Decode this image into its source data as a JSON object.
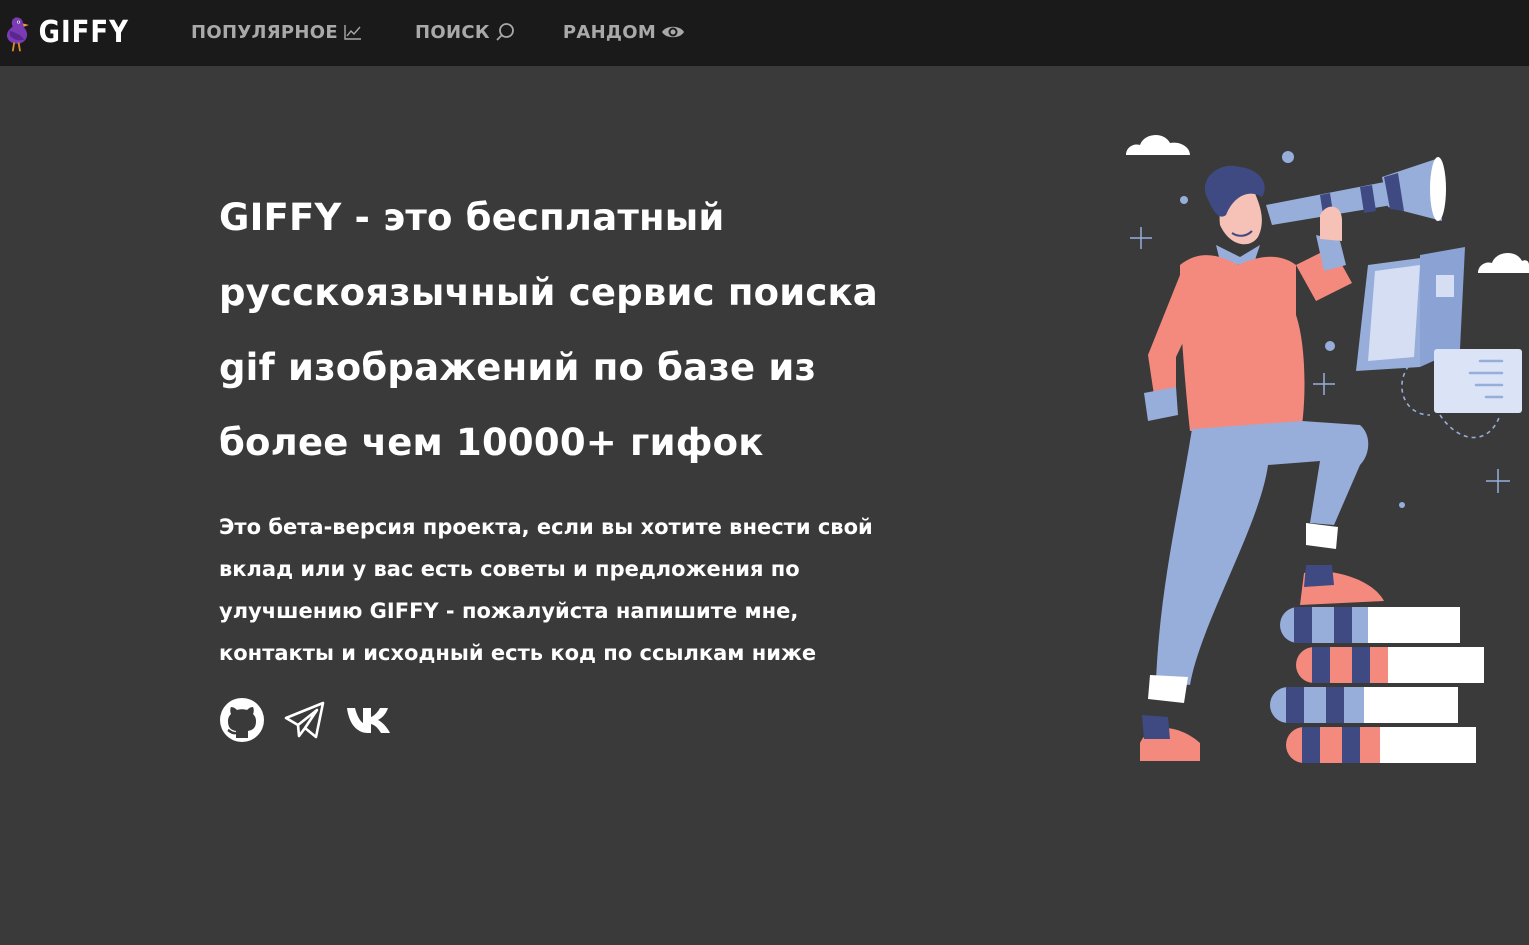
{
  "header": {
    "logo_text": "GIFFY",
    "nav": [
      {
        "label": "ПОПУЛЯРНОЕ",
        "icon": "trending-chart-icon"
      },
      {
        "label": "ПОИСК",
        "icon": "search-icon"
      },
      {
        "label": "РАНДОМ",
        "icon": "eye-icon"
      }
    ]
  },
  "hero": {
    "title": "GIFFY - это бесплатный русскоязычный сервис поиска gif изображений по базе из более чем 10000+ гифок",
    "text": "Это бета-версия проекта, если вы хотите внести свой вклад или у вас есть советы и предложения по улучшению GIFFY - пожалуйста напишите мне, контакты и исходный есть код по ссылкам ниже"
  },
  "socials": [
    {
      "icon": "github-icon"
    },
    {
      "icon": "telegram-icon"
    },
    {
      "icon": "vk-icon"
    }
  ],
  "colors": {
    "background": "#3a3a3b",
    "header": "#1a1a1a",
    "nav_text": "#a9a9a9",
    "text": "#ffffff",
    "accent_pink": "#f48a7e",
    "accent_blue": "#97aedb",
    "accent_navy": "#3f4a83"
  }
}
